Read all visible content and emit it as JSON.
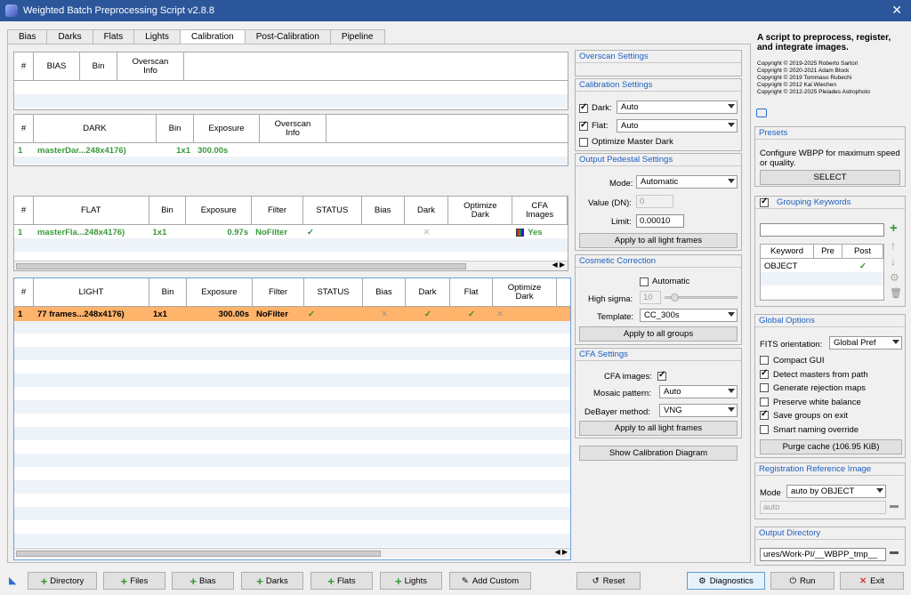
{
  "window": {
    "title": "Weighted Batch Preprocessing Script v2.8.8"
  },
  "tabs": [
    "Bias",
    "Darks",
    "Flats",
    "Lights",
    "Calibration",
    "Post-Calibration",
    "Pipeline"
  ],
  "bias_table": {
    "headers": [
      "#",
      "BIAS",
      "Bin",
      "Overscan\nInfo"
    ]
  },
  "dark_table": {
    "headers": [
      "#",
      "DARK",
      "Bin",
      "Exposure",
      "Overscan\nInfo"
    ],
    "rows": [
      [
        "1",
        "masterDar...248x4176)",
        "1x1",
        "300.00s",
        ""
      ]
    ]
  },
  "flat_table": {
    "headers": [
      "#",
      "FLAT",
      "Bin",
      "Exposure",
      "Filter",
      "STATUS",
      "Bias",
      "Dark",
      "Optimize\nDark",
      "CFA\nImages"
    ],
    "rows": [
      [
        "1",
        "masterFla...248x4176)",
        "1x1",
        "0.97s",
        "NoFilter",
        "✓",
        "",
        "✕",
        "",
        "Yes"
      ]
    ]
  },
  "light_table": {
    "headers": [
      "#",
      "LIGHT",
      "Bin",
      "Exposure",
      "Filter",
      "STATUS",
      "Bias",
      "Dark",
      "Flat",
      "Optimize\nDark"
    ],
    "rows": [
      [
        "1",
        "77 frames...248x4176)",
        "1x1",
        "300.00s",
        "NoFilter",
        "✓",
        "✕",
        "✓",
        "✓",
        "✕"
      ]
    ]
  },
  "overscan": {
    "title": "Overscan Settings"
  },
  "calibration": {
    "title": "Calibration Settings",
    "dark_label": "Dark:",
    "dark_value": "Auto",
    "flat_label": "Flat:",
    "flat_value": "Auto",
    "optimize_label": "Optimize Master Dark"
  },
  "pedestal": {
    "title": "Output Pedestal Settings",
    "mode_label": "Mode:",
    "mode_value": "Automatic",
    "value_label": "Value (DN):",
    "value_value": "0",
    "limit_label": "Limit:",
    "limit_value": "0.00010",
    "apply_label": "Apply to all light frames"
  },
  "cosmetic": {
    "title": "Cosmetic Correction",
    "automatic_label": "Automatic",
    "sigma_label": "High sigma:",
    "sigma_value": "10",
    "template_label": "Template:",
    "template_value": "CC_300s",
    "apply_label": "Apply to all groups"
  },
  "cfa": {
    "title": "CFA Settings",
    "images_label": "CFA images:",
    "mosaic_label": "Mosaic pattern:",
    "mosaic_value": "Auto",
    "debayer_label": "DeBayer method:",
    "debayer_value": "VNG",
    "apply_label": "Apply to all light frames"
  },
  "show_diagram_label": "Show Calibration Diagram",
  "info": {
    "heading": "A script to preprocess, register, and integrate images.",
    "copyrights": [
      "Copyright © 2019-2025 Roberto Sartori",
      "Copyright © 2020-2021 Adam Block",
      "Copyright © 2019 Tommaso Rubechi",
      "Copyright © 2012 Kai Wiechen",
      "Copyright © 2012-2025 Pleiades Astrophoto"
    ]
  },
  "presets": {
    "title": "Presets",
    "text": "Configure WBPP for maximum speed or quality.",
    "select_label": "SELECT"
  },
  "grouping": {
    "title": "Grouping Keywords",
    "headers": [
      "Keyword",
      "Pre",
      "Post"
    ],
    "rows": [
      [
        "OBJECT",
        "",
        "✓"
      ]
    ]
  },
  "global": {
    "title": "Global Options",
    "fits_label": "FITS orientation:",
    "fits_value": "Global Pref",
    "options": [
      {
        "label": "Compact GUI",
        "checked": false
      },
      {
        "label": "Detect masters from path",
        "checked": true
      },
      {
        "label": "Generate rejection maps",
        "checked": false
      },
      {
        "label": "Preserve white balance",
        "checked": false
      },
      {
        "label": "Save groups on exit",
        "checked": true
      },
      {
        "label": "Smart naming override",
        "checked": false
      }
    ],
    "purge_label": "Purge cache (106.95 KiB)"
  },
  "registration": {
    "title": "Registration Reference Image",
    "mode_label": "Mode",
    "mode_value": "auto by OBJECT",
    "ref_value": "auto"
  },
  "output": {
    "title": "Output Directory",
    "path": "ures/Work-PI/__WBPP_tmp__"
  },
  "bottom": {
    "directory": "Directory",
    "files": "Files",
    "bias": "Bias",
    "darks": "Darks",
    "flats": "Flats",
    "lights": "Lights",
    "add_custom": "Add Custom",
    "reset": "Reset",
    "diagnostics": "Diagnostics",
    "run": "Run",
    "exit": "Exit"
  }
}
